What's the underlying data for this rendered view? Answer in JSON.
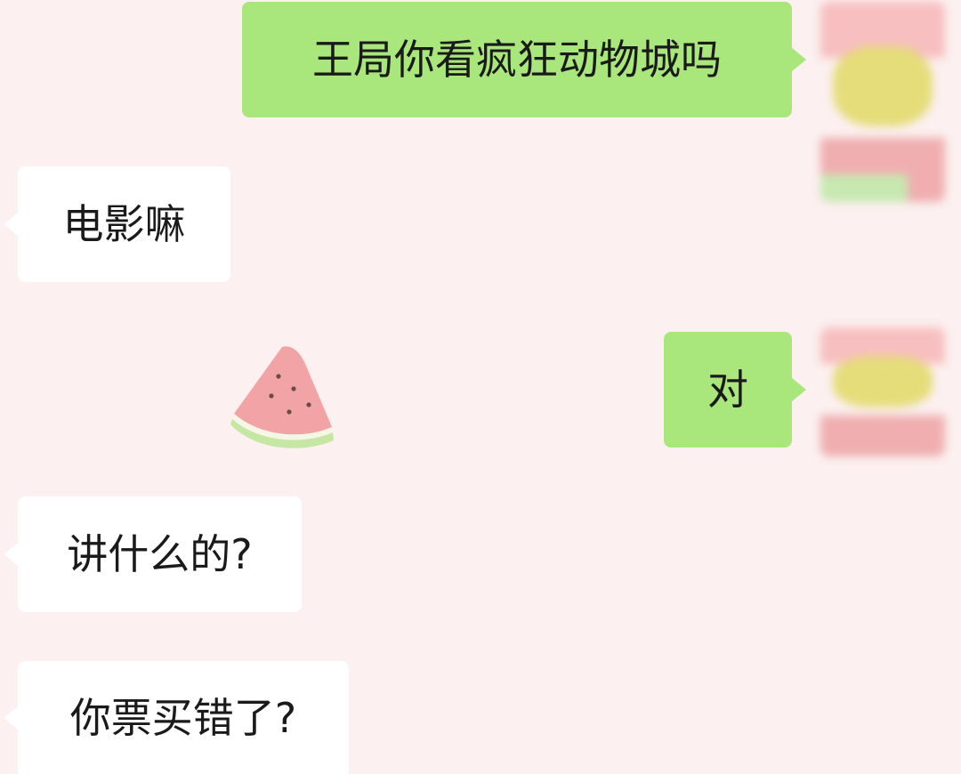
{
  "messages": [
    {
      "side": "out",
      "text": "王局你看疯狂动物城吗"
    },
    {
      "side": "in",
      "text": "电影嘛"
    },
    {
      "side": "out",
      "text": "对"
    },
    {
      "side": "in",
      "text": "讲什么的?"
    },
    {
      "side": "in",
      "text": "你票买错了?"
    }
  ],
  "sticker": {
    "icon": "watermelon-slice-icon"
  },
  "colors": {
    "background": "#fcf0f0",
    "outgoing_bubble": "#a9e67c",
    "incoming_bubble": "#ffffff",
    "text": "#1a1a1a"
  }
}
